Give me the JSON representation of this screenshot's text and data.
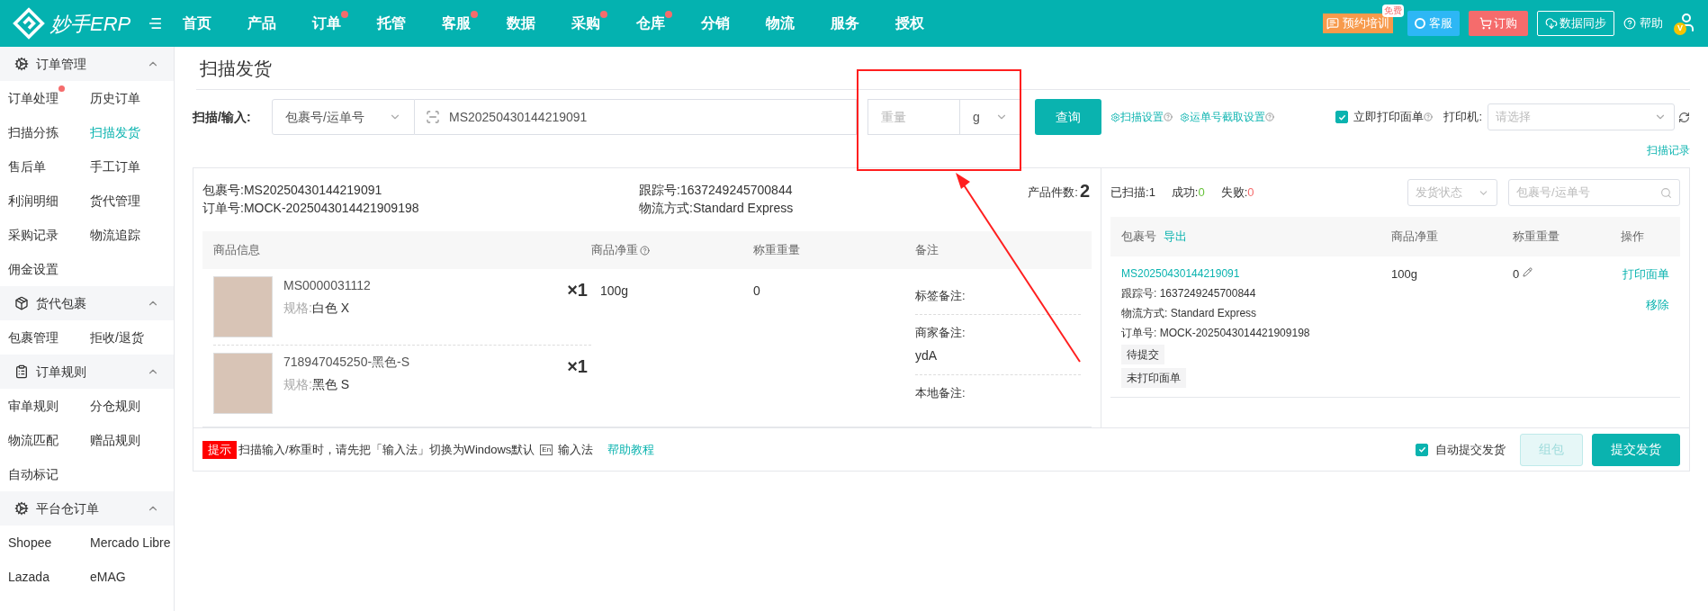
{
  "header": {
    "logo": "妙手ERP",
    "nav": [
      {
        "label": "首页",
        "dot": false
      },
      {
        "label": "产品",
        "dot": false
      },
      {
        "label": "订单",
        "dot": true
      },
      {
        "label": "托管",
        "dot": false
      },
      {
        "label": "客服",
        "dot": true
      },
      {
        "label": "数据",
        "dot": false
      },
      {
        "label": "采购",
        "dot": true
      },
      {
        "label": "仓库",
        "dot": true
      },
      {
        "label": "分销",
        "dot": false
      },
      {
        "label": "物流",
        "dot": false
      },
      {
        "label": "服务",
        "dot": false
      },
      {
        "label": "授权",
        "dot": false
      }
    ],
    "training": {
      "label": "预约培训",
      "badge": "免费"
    },
    "service": "客服",
    "order": "订购",
    "sync": "数据同步",
    "help": "帮助",
    "avatar_badge": "V"
  },
  "sidebar": [
    {
      "title": "订单管理",
      "kind": "gear",
      "expanded": true,
      "items": [
        {
          "label": "订单处理",
          "selected": false,
          "dot": true
        },
        {
          "label": "历史订单",
          "selected": false,
          "dot": false
        },
        {
          "label": "扫描分拣",
          "selected": false,
          "dot": false
        },
        {
          "label": "扫描发货",
          "selected": true,
          "dot": false
        },
        {
          "label": "售后单",
          "selected": false,
          "dot": false
        },
        {
          "label": "手工订单",
          "selected": false,
          "dot": false
        },
        {
          "label": "利润明细",
          "selected": false,
          "dot": false
        },
        {
          "label": "货代管理",
          "selected": false,
          "dot": false
        },
        {
          "label": "采购记录",
          "selected": false,
          "dot": false
        },
        {
          "label": "物流追踪",
          "selected": false,
          "dot": false
        },
        {
          "label": "佣金设置",
          "selected": false,
          "dot": false
        }
      ]
    },
    {
      "title": "货代包裹",
      "kind": "box",
      "expanded": true,
      "items": [
        {
          "label": "包裹管理",
          "selected": false,
          "dot": false
        },
        {
          "label": "拒收/退货",
          "selected": false,
          "dot": false
        }
      ]
    },
    {
      "title": "订单规则",
      "kind": "clipboard",
      "expanded": true,
      "items": [
        {
          "label": "审单规则",
          "selected": false,
          "dot": false
        },
        {
          "label": "分仓规则",
          "selected": false,
          "dot": false
        },
        {
          "label": "物流匹配",
          "selected": false,
          "dot": false
        },
        {
          "label": "赠品规则",
          "selected": false,
          "dot": false
        },
        {
          "label": "自动标记",
          "selected": false,
          "dot": false
        }
      ]
    },
    {
      "title": "平台仓订单",
      "kind": "gear",
      "expanded": true,
      "items": [
        {
          "label": "Shopee",
          "selected": false,
          "dot": false
        },
        {
          "label": "Mercado Libre",
          "selected": false,
          "dot": false
        },
        {
          "label": "Lazada",
          "selected": false,
          "dot": false
        },
        {
          "label": "eMAG",
          "selected": false,
          "dot": false
        }
      ]
    }
  ],
  "page_title": "扫描发货",
  "scan": {
    "label": "扫描/输入:",
    "type": "包裹号/运单号",
    "value": "MS20250430144219091",
    "weight_placeholder": "重量",
    "unit": "g",
    "query": "查询",
    "scan_settings": "扫描设置",
    "waybill_settings": "运单号截取设置",
    "print_now": {
      "label": "立即打印面单",
      "checked": true
    },
    "printer_label": "打印机:",
    "printer_placeholder": "请选择",
    "records": "扫描记录"
  },
  "package": {
    "package_no_label": "包裹号:",
    "package_no": "MS20250430144219091",
    "order_no_label": "订单号:",
    "order_no": "MOCK-2025043014421909198",
    "tracking_label": "跟踪号:",
    "tracking": "1637249245700844",
    "shipping_label": "物流方式:",
    "shipping": "Standard Express",
    "count_label": "产品件数:",
    "count": "2",
    "columns": [
      "商品信息",
      "商品净重",
      "称重重量",
      "备注"
    ],
    "products": [
      {
        "sku": "MS0000031112",
        "spec_label": "规格:",
        "spec": "白色 X",
        "qty": "×1"
      },
      {
        "sku": "718947045250-黑色-S",
        "spec_label": "规格:",
        "spec": "黑色 S",
        "qty": "×1"
      }
    ],
    "net_weight": "100g",
    "weighed": "0",
    "notes": [
      {
        "label": "标签备注:"
      },
      {
        "label": "商家备注:",
        "value": "ydA"
      },
      {
        "label": "本地备注:"
      }
    ]
  },
  "stats": {
    "scanned_label": "已扫描:",
    "scanned": "1",
    "success_label": "成功:",
    "success": "0",
    "failed_label": "失败:",
    "failed": "0",
    "status_placeholder": "发货状态",
    "search_placeholder": "包裹号/运单号"
  },
  "scanned_table": {
    "columns": [
      "包裹号",
      "商品净重",
      "称重重量",
      "操作"
    ],
    "export": "导出",
    "rows": [
      {
        "package_no": "MS20250430144219091",
        "tracking_label": "跟踪号:",
        "tracking": "1637249245700844",
        "shipping_label": "物流方式:",
        "shipping": "Standard Express",
        "order_label": "订单号:",
        "order": "MOCK-2025043014421909198",
        "tags": [
          "待提交",
          "未打印面单"
        ],
        "net_weight": "100g",
        "weighed": "0",
        "actions": [
          "打印面单",
          "移除"
        ]
      }
    ]
  },
  "footer": {
    "tip_badge": "提示",
    "tip": "扫描输入/称重时，请先把「输入法」切换为Windows默认",
    "ime_key": "En",
    "ime": "输入法",
    "help": "帮助教程",
    "auto_submit": {
      "label": "自动提交发货",
      "checked": true
    },
    "pack": {
      "label": "组包",
      "disabled": true
    },
    "submit": {
      "label": "提交发货",
      "disabled": false
    }
  }
}
